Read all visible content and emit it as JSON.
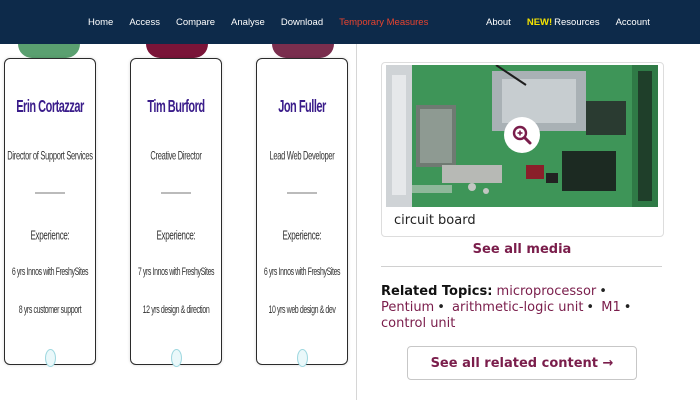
{
  "nav": {
    "left": [
      "Home",
      "Access",
      "Compare",
      "Analyse",
      "Download",
      "Temporary Measures"
    ],
    "right": {
      "about": "About",
      "new_badge": "NEW!",
      "resources": "Resources",
      "account": "Account"
    }
  },
  "team": [
    {
      "name": "Erin Cortazzar",
      "role": "Director of Support Services",
      "experience_heading": "Experience:",
      "exp1": "6 yrs Innos with FreshySites",
      "exp2": "8 yrs customer support"
    },
    {
      "name": "Tim Burford",
      "role": "Creative Director",
      "experience_heading": "Experience:",
      "exp1": "7 yrs Innos with FreshySites",
      "exp2": "12 yrs design & direction"
    },
    {
      "name": "Jon Fuller",
      "role": "Lead Web Developer",
      "experience_heading": "Experience:",
      "exp1": "6 yrs Innos with FreshySites",
      "exp2": "10 yrs web design & dev"
    }
  ],
  "media": {
    "caption": "circuit board",
    "see_all": "See all media"
  },
  "related": {
    "label": "Related Topics:",
    "topics": [
      "microprocessor",
      "Pentium",
      "arithmetic-logic unit",
      "M1",
      "control unit"
    ],
    "button": "See all related content →"
  },
  "colors": {
    "nav_bg": "#0d2a4a",
    "accent": "#7a1d4b",
    "name": "#3a1c8a",
    "temp_measures": "#e8432e",
    "new_badge": "#f5e300"
  },
  "icons": {
    "zoom": "magnifier-zoom-icon"
  }
}
